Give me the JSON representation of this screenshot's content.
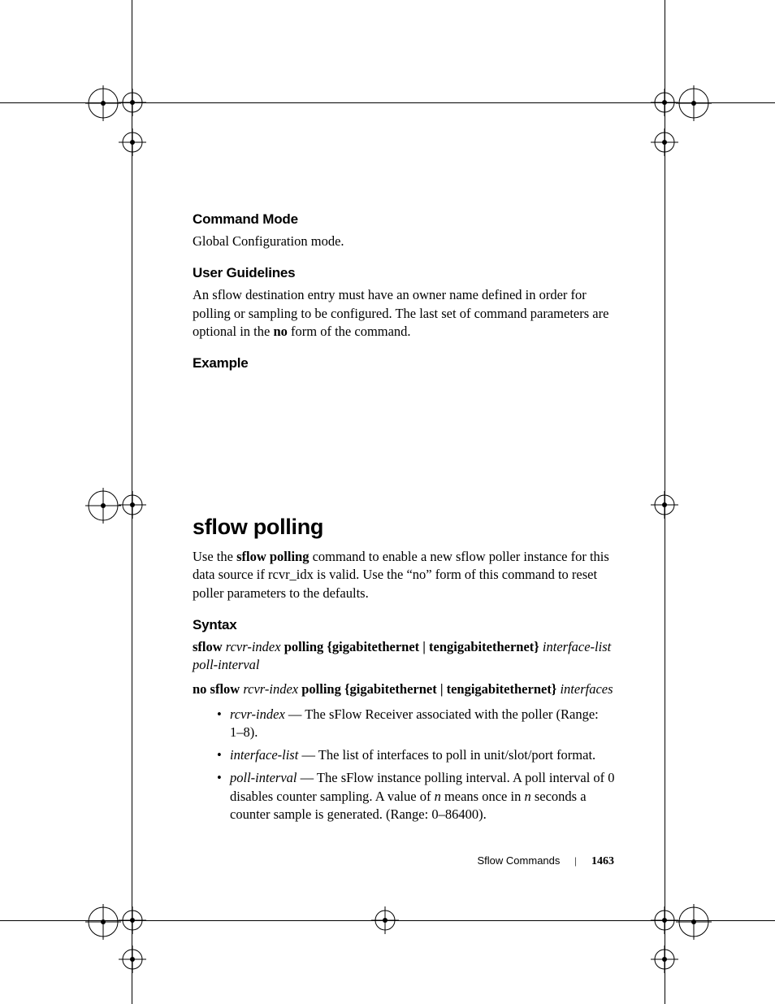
{
  "sections": {
    "commandMode": {
      "heading": "Command Mode",
      "body": "Global Configuration mode."
    },
    "userGuidelines": {
      "heading": "User Guidelines",
      "body_pre": "An sflow destination entry must have an owner name defined in order for polling or sampling to be configured. The last set of command parameters are optional in the ",
      "body_bold": "no",
      "body_post": " form of the command."
    },
    "example": {
      "heading": "Example"
    },
    "sflowPolling": {
      "title": "sflow polling",
      "intro_pre": "Use the ",
      "intro_bold": "sflow polling",
      "intro_post": " command to enable a new sflow poller instance for this data source if rcvr_idx is valid. Use the “no” form of this command to reset poller parameters to the defaults."
    },
    "syntax": {
      "heading": "Syntax",
      "line1": {
        "p1_bold": "sflow ",
        "p2_ital": "rcvr-index",
        "p3_bold": " polling {gigabitethernet | tengigabitethernet} ",
        "p4_ital": "interface-list poll-interval"
      },
      "line2": {
        "p1_bold": "no sflow ",
        "p2_ital": "rcvr-index",
        "p3_bold": " polling {gigabitethernet | tengigabitethernet} ",
        "p4_ital": "interfaces"
      },
      "bullets": [
        {
          "term": "rcvr-index",
          "rest": " — The sFlow Receiver associated with the poller (Range: 1–8)."
        },
        {
          "term": "interface-list",
          "rest": " — The list of interfaces to poll in unit/slot/port format."
        },
        {
          "term": "poll-interval",
          "rest_pre": " — The sFlow instance polling interval. A poll interval of 0 disables counter sampling. A value of ",
          "n1": "n",
          "rest_mid": " means once in ",
          "n2": "n",
          "rest_post": " seconds a counter sample is generated. (Range: 0–86400)."
        }
      ]
    }
  },
  "footer": {
    "title": "Sflow Commands",
    "page": "1463"
  }
}
